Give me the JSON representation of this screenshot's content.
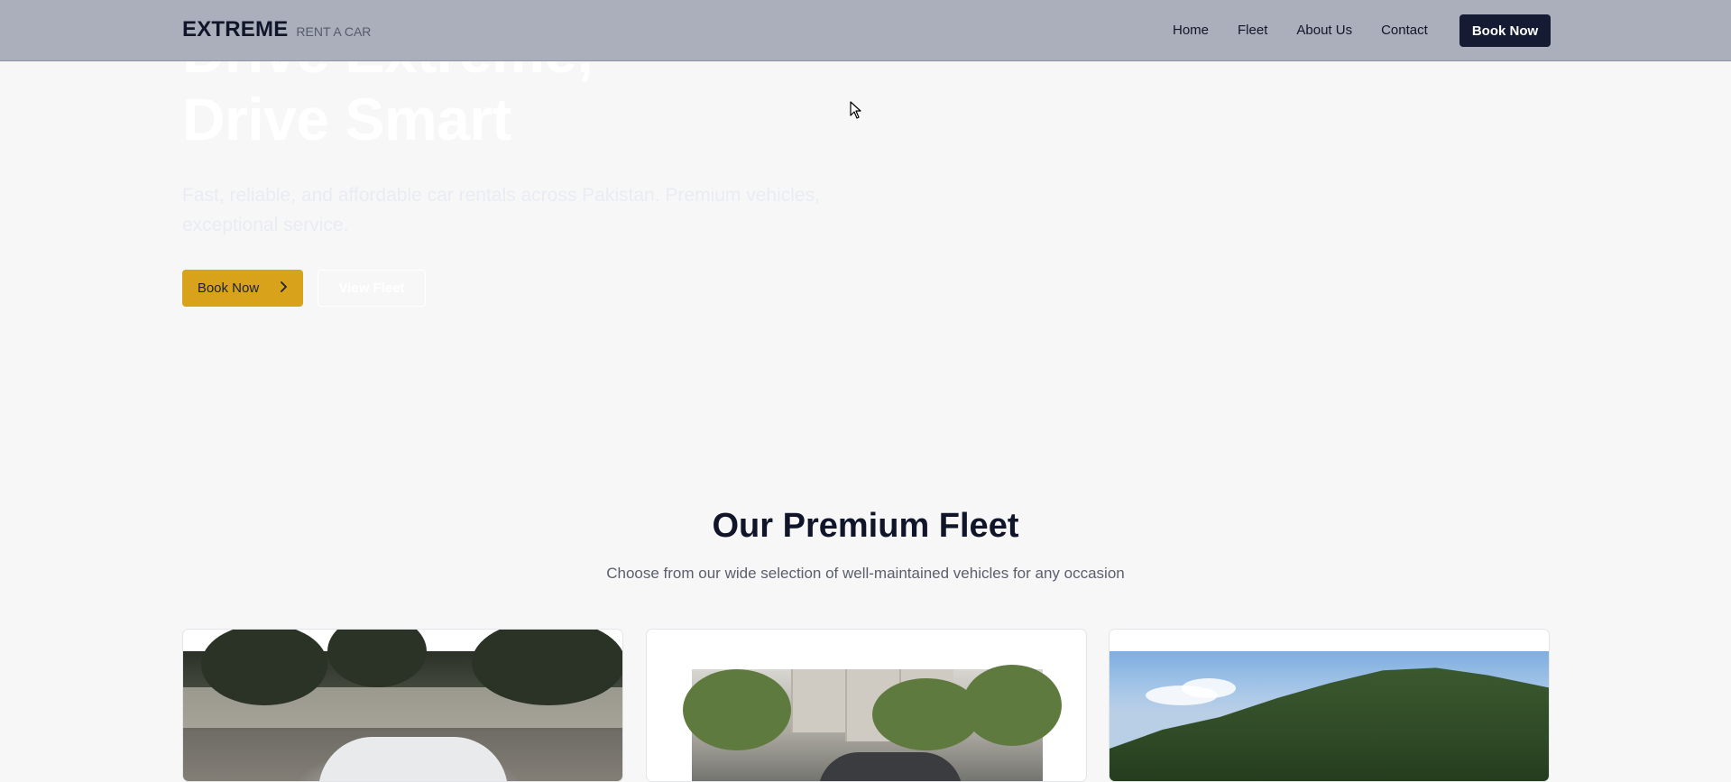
{
  "nav": {
    "brand": "EXTREME",
    "brand_sub": "RENT A CAR",
    "links": [
      "Home",
      "Fleet",
      "About Us",
      "Contact"
    ],
    "cta": "Book Now"
  },
  "hero": {
    "title_line1": "Drive Extreme,",
    "title_line2": "Drive Smart",
    "subtitle": "Fast, reliable, and affordable car rentals across Pakistan. Premium vehicles, exceptional service.",
    "primary_button": "Book Now",
    "secondary_button": "View Fleet"
  },
  "fleet": {
    "title": "Our Premium Fleet",
    "subtitle": "Choose from our wide selection of well-maintained vehicles for any occasion"
  },
  "icons": {
    "primary_button_icon": "chevron-right-icon",
    "cursor": "mouse-pointer-icon"
  },
  "colors": {
    "accent": "#d8a21a",
    "navy": "#141b33",
    "hero_dark": "#172140",
    "nav_bg": "#a9adba",
    "page_bg": "#f7f7f8"
  }
}
